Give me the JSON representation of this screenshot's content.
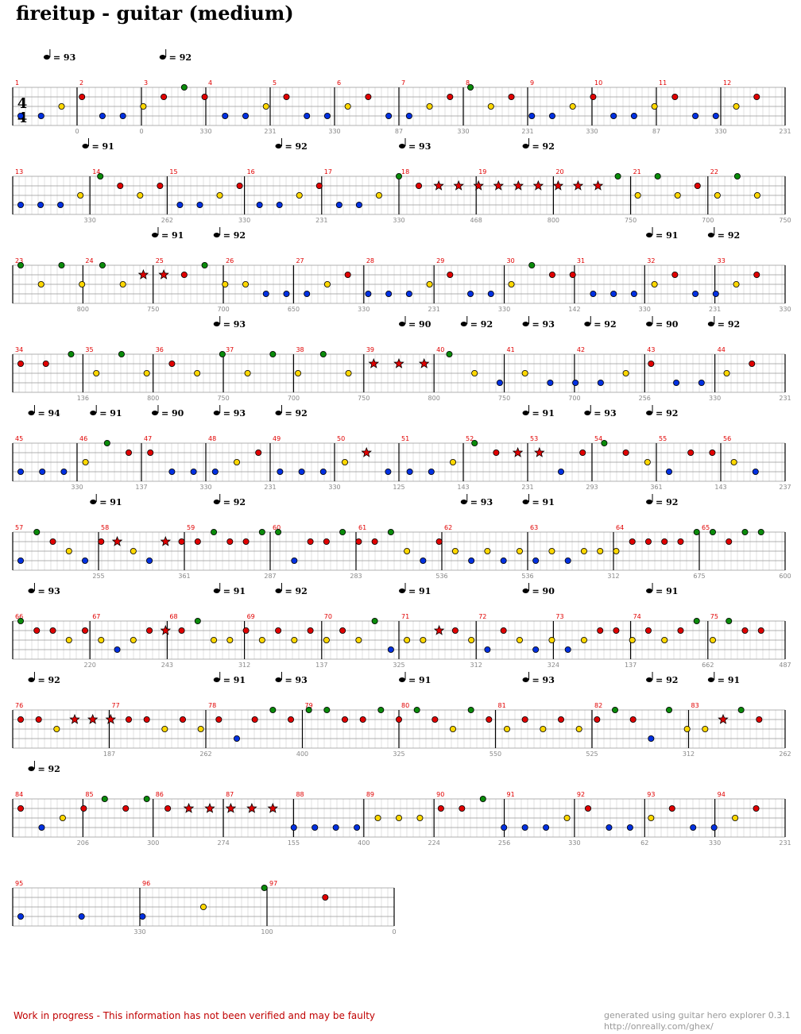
{
  "title": "fireitup - guitar (medium)",
  "footer": {
    "warning": "Work in progress - This information has not been verified and may be faulty",
    "generator_line1": "generated using guitar hero explorer 0.3.1",
    "generator_line2": "http://onreally.com/ghex/"
  },
  "chart_data": {
    "time_signature": {
      "top": "4",
      "bottom": "4"
    },
    "lane_colors": {
      "green": "#0a8a0a",
      "red": "#e00000",
      "yellow": "#ffd700",
      "blue": "#0030e0",
      "orange": "#ff8c00"
    },
    "systems": [
      {
        "measures": [
          "1",
          "2",
          "3",
          "4",
          "5",
          "6",
          "7",
          "8",
          "9",
          "10",
          "11",
          "12"
        ],
        "tempos": [
          {
            "bpm": "93",
            "at": 0.04
          },
          {
            "bpm": "92",
            "at": 0.19
          }
        ],
        "scores": [
          "0",
          "0",
          "330",
          "231",
          "330",
          "87",
          "330",
          "231",
          "330",
          "87",
          "330",
          "231"
        ],
        "notes": "b b y r b b y r g r b b y r b b y r b b y r g y r b b y r b b y r b b y r"
      },
      {
        "measures": [
          "13",
          "14",
          "15",
          "16",
          "17",
          "18",
          "19",
          "20",
          "21",
          "22"
        ],
        "tempos": [
          {
            "bpm": "91",
            "at": 0.09
          },
          {
            "bpm": "92",
            "at": 0.34
          },
          {
            "bpm": "93",
            "at": 0.5
          },
          {
            "bpm": "92",
            "at": 0.66
          }
        ],
        "scores": [
          "330",
          "262",
          "330",
          "231",
          "330",
          "468",
          "800",
          "750",
          "700",
          "750"
        ],
        "notes": "b b b y g r y r b b y r b b y r b b y g r s s s s s s s s s g y g y r y g y"
      },
      {
        "measures": [
          "23",
          "24",
          "25",
          "26",
          "27",
          "28",
          "29",
          "30",
          "31",
          "32",
          "33"
        ],
        "tempos": [
          {
            "bpm": "91",
            "at": 0.18
          },
          {
            "bpm": "92",
            "at": 0.26
          },
          {
            "bpm": "91",
            "at": 0.82
          },
          {
            "bpm": "92",
            "at": 0.9
          }
        ],
        "scores": [
          "800",
          "750",
          "700",
          "650",
          "330",
          "231",
          "330",
          "142",
          "330",
          "231",
          "330"
        ],
        "notes": "g y g y g y s s r g y y b b b y r b b b y r b b y g r r b b b y r b b y r"
      },
      {
        "measures": [
          "34",
          "35",
          "36",
          "37",
          "38",
          "39",
          "40",
          "41",
          "42",
          "43",
          "44"
        ],
        "tempos": [
          {
            "bpm": "93",
            "at": 0.26
          },
          {
            "bpm": "90",
            "at": 0.5
          },
          {
            "bpm": "92",
            "at": 0.58
          },
          {
            "bpm": "93",
            "at": 0.66
          },
          {
            "bpm": "92",
            "at": 0.74
          },
          {
            "bpm": "90",
            "at": 0.82
          },
          {
            "bpm": "92",
            "at": 0.9
          }
        ],
        "scores": [
          "136",
          "800",
          "750",
          "700",
          "750",
          "800",
          "750",
          "700",
          "256",
          "330",
          "231"
        ],
        "notes": "r r g y g y r y g y g y g y s s s g y b y b b b y r b b y r"
      },
      {
        "measures": [
          "45",
          "46",
          "47",
          "48",
          "49",
          "50",
          "51",
          "52",
          "53",
          "54",
          "55",
          "56"
        ],
        "tempos": [
          {
            "bpm": "94",
            "at": 0.02
          },
          {
            "bpm": "91",
            "at": 0.1
          },
          {
            "bpm": "90",
            "at": 0.18
          },
          {
            "bpm": "93",
            "at": 0.26
          },
          {
            "bpm": "92",
            "at": 0.34
          },
          {
            "bpm": "91",
            "at": 0.66
          },
          {
            "bpm": "93",
            "at": 0.74
          },
          {
            "bpm": "92",
            "at": 0.82
          }
        ],
        "scores": [
          "330",
          "137",
          "330",
          "231",
          "330",
          "125",
          "143",
          "231",
          "293",
          "361",
          "143",
          "237"
        ],
        "notes": "b b b y g r r b b b y r b b b y s b b b y g r s s b r g r y b r r y b"
      },
      {
        "measures": [
          "57",
          "58",
          "59",
          "60",
          "61",
          "62",
          "63",
          "64",
          "65"
        ],
        "tempos": [
          {
            "bpm": "91",
            "at": 0.1
          },
          {
            "bpm": "92",
            "at": 0.26
          },
          {
            "bpm": "93",
            "at": 0.58
          },
          {
            "bpm": "91",
            "at": 0.66
          },
          {
            "bpm": "92",
            "at": 0.82
          }
        ],
        "scores": [
          "255",
          "361",
          "287",
          "283",
          "536",
          "536",
          "312",
          "675",
          "600"
        ],
        "notes": "b g r y b r s y b s r r g r r g g b r r g r r g y b r y b y b y b y b y y y r r r r g g r g g"
      },
      {
        "measures": [
          "66",
          "67",
          "68",
          "69",
          "70",
          "71",
          "72",
          "73",
          "74",
          "75"
        ],
        "tempos": [
          {
            "bpm": "93",
            "at": 0.02
          },
          {
            "bpm": "91",
            "at": 0.26
          },
          {
            "bpm": "92",
            "at": 0.34
          },
          {
            "bpm": "91",
            "at": 0.5
          },
          {
            "bpm": "90",
            "at": 0.66
          },
          {
            "bpm": "91",
            "at": 0.82
          }
        ],
        "scores": [
          "220",
          "243",
          "312",
          "137",
          "325",
          "312",
          "324",
          "137",
          "662",
          "487"
        ],
        "notes": "g r r y r y b y r s r g y y r y r y r y r y g b y y s r y b r y b y b y r r y r y r g y g r r"
      },
      {
        "measures": [
          "76",
          "77",
          "78",
          "79",
          "80",
          "81",
          "82",
          "83"
        ],
        "tempos": [
          {
            "bpm": "92",
            "at": 0.02
          },
          {
            "bpm": "91",
            "at": 0.26
          },
          {
            "bpm": "93",
            "at": 0.34
          },
          {
            "bpm": "91",
            "at": 0.5
          },
          {
            "bpm": "93",
            "at": 0.66
          },
          {
            "bpm": "92",
            "at": 0.82
          },
          {
            "bpm": "91",
            "at": 0.9
          }
        ],
        "scores": [
          "187",
          "262",
          "400",
          "325",
          "550",
          "525",
          "312",
          "262"
        ],
        "notes": "r r y s s s r r y r y r b r g r g g r r g r g r y g r y r y r y r g r b g y y s g r"
      },
      {
        "measures": [
          "84",
          "85",
          "86",
          "87",
          "88",
          "89",
          "90",
          "91",
          "92",
          "93",
          "94"
        ],
        "tempos": [
          {
            "bpm": "92",
            "at": 0.02
          }
        ],
        "scores": [
          "206",
          "300",
          "274",
          "155",
          "400",
          "224",
          "256",
          "330",
          "62",
          "330",
          "231"
        ],
        "notes": "r b y r g r g r s s s s s b b b b y y y r r g b b b y r b b y r b b y r"
      },
      {
        "measures": [
          "95",
          "96",
          "97"
        ],
        "tempos": [],
        "scores": [
          "330",
          "100",
          "0"
        ],
        "notes": "b b b y g r"
      }
    ]
  }
}
